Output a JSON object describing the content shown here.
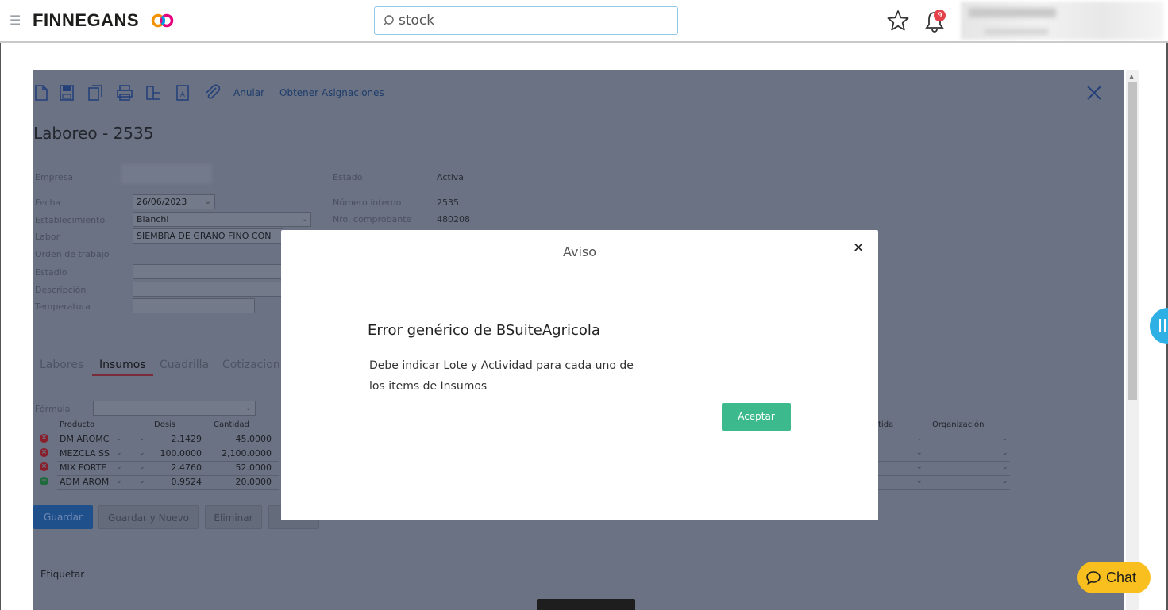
{
  "header": {
    "logo_text": "FINNEGANS",
    "search_value": "stock",
    "notification_count": "9"
  },
  "toolbar": {
    "anular": "Anular",
    "obtener": "Obtener Asignaciones"
  },
  "document": {
    "title": "Laboreo - 2535",
    "labels": {
      "empresa": "Empresa",
      "fecha": "Fecha",
      "establecimiento": "Establecimiento",
      "labor": "Labor",
      "orden": "Orden de trabajo",
      "estadio": "Estadio",
      "descripcion": "Descripción",
      "temperatura": "Temperatura",
      "estado": "Estado",
      "numero_interno": "Número interno",
      "nro_comprobante": "Nro. comprobante"
    },
    "values": {
      "fecha": "26/06/2023",
      "establecimiento": "Bianchi",
      "labor": "SIEMBRA DE GRANO FINO CON",
      "estado": "Activa",
      "numero_interno": "2535",
      "nro_comprobante": "480208"
    }
  },
  "tabs": [
    "Labores",
    "Insumos",
    "Cuadrilla",
    "Cotizacion"
  ],
  "insumos": {
    "formula_label": "Fórmula",
    "columns": {
      "producto": "Producto",
      "dosis": "Dosis",
      "cantidad": "Cantidad",
      "partida": "tida",
      "organizacion": "Organización"
    },
    "rows": [
      {
        "producto": "DM AROMC",
        "dosis": "2.1429",
        "cantidad": "45.0000",
        "status": "remove"
      },
      {
        "producto": "MEZCLA SS",
        "dosis": "100.0000",
        "cantidad": "2,100.0000",
        "status": "remove"
      },
      {
        "producto": "MIX FORTE",
        "dosis": "2.4760",
        "cantidad": "52.0000",
        "status": "remove"
      },
      {
        "producto": "ADM AROM",
        "dosis": "0.9524",
        "cantidad": "20.0000",
        "status": "add"
      }
    ]
  },
  "buttons": {
    "guardar": "Guardar",
    "guardar_nuevo": "Guardar y Nuevo",
    "eliminar": "Eliminar"
  },
  "etiquetar": "Etiquetar",
  "modal": {
    "title": "Aviso",
    "heading": "Error genérico de BSuiteAgricola",
    "message_line1": "Debe indicar Lote y Actividad para cada uno de",
    "message_line2": "los items de Insumos",
    "ok_label": "Aceptar"
  },
  "chat": {
    "label": "Chat"
  },
  "colors": {
    "overlay": "#6b7283",
    "accept": "#3cba8e",
    "chat": "#f8bf1f",
    "side_handle": "#2fb0e4",
    "badge": "#e4414b"
  }
}
